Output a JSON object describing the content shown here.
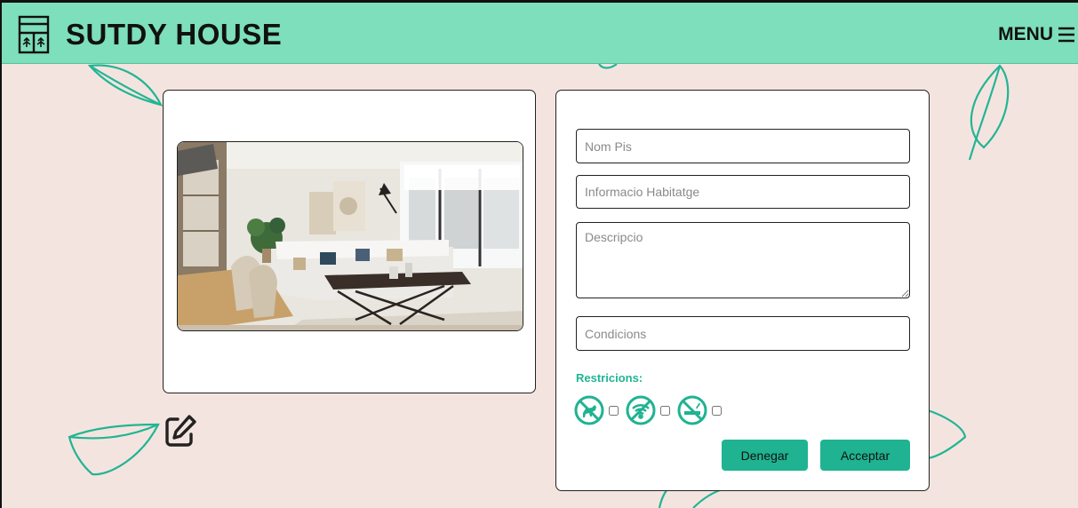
{
  "header": {
    "brand": "SUTDY HOUSE",
    "menu_label": "MENU",
    "background": "#7ddfbb",
    "logo_icon": "storefront-icon",
    "menu_icon": "hamburger-icon"
  },
  "colors": {
    "page_background": "#f4e4df",
    "accent": "#1fb391",
    "leaf_stroke": "#21b594"
  },
  "listing": {
    "photo_icon": "living-room-photo",
    "edit_icon": "edit-icon"
  },
  "form": {
    "nom_pis_placeholder": "Nom Pis",
    "info_placeholder": "Informacio Habitatge",
    "descripcio_placeholder": "Descripcio",
    "condicions_placeholder": "Condicions",
    "restrictions_label": "Restricions:",
    "restrictions": [
      {
        "icon": "no-pets-icon",
        "checked": false
      },
      {
        "icon": "no-wifi-icon",
        "checked": false
      },
      {
        "icon": "no-smoking-icon",
        "checked": false
      }
    ],
    "deny_label": "Denegar",
    "accept_label": "Acceptar"
  }
}
